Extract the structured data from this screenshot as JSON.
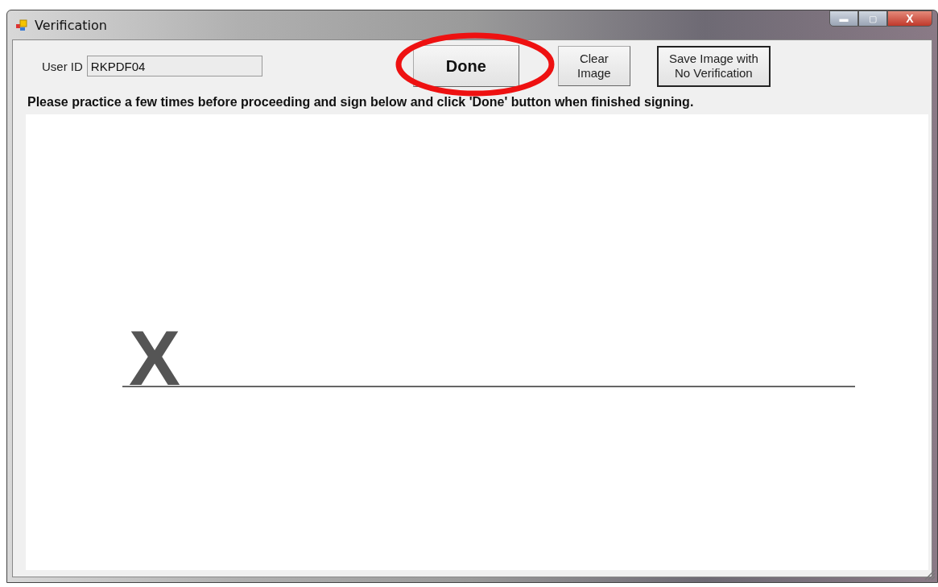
{
  "window": {
    "title": "Verification"
  },
  "user_id": {
    "label": "User ID",
    "value": "RKPDF04"
  },
  "buttons": [
    {
      "label": "Done",
      "kind": "primary"
    },
    {
      "label": "Clear\nImage",
      "kind": "normal"
    },
    {
      "label": "Save Image with\nNo Verification",
      "kind": "default"
    }
  ],
  "instruction": "Please practice a few times before proceeding and sign below and click 'Done' button when finished signing.",
  "signature_pad": {
    "mark": "X"
  },
  "title_controls": [
    "▬",
    "▢",
    "X"
  ]
}
